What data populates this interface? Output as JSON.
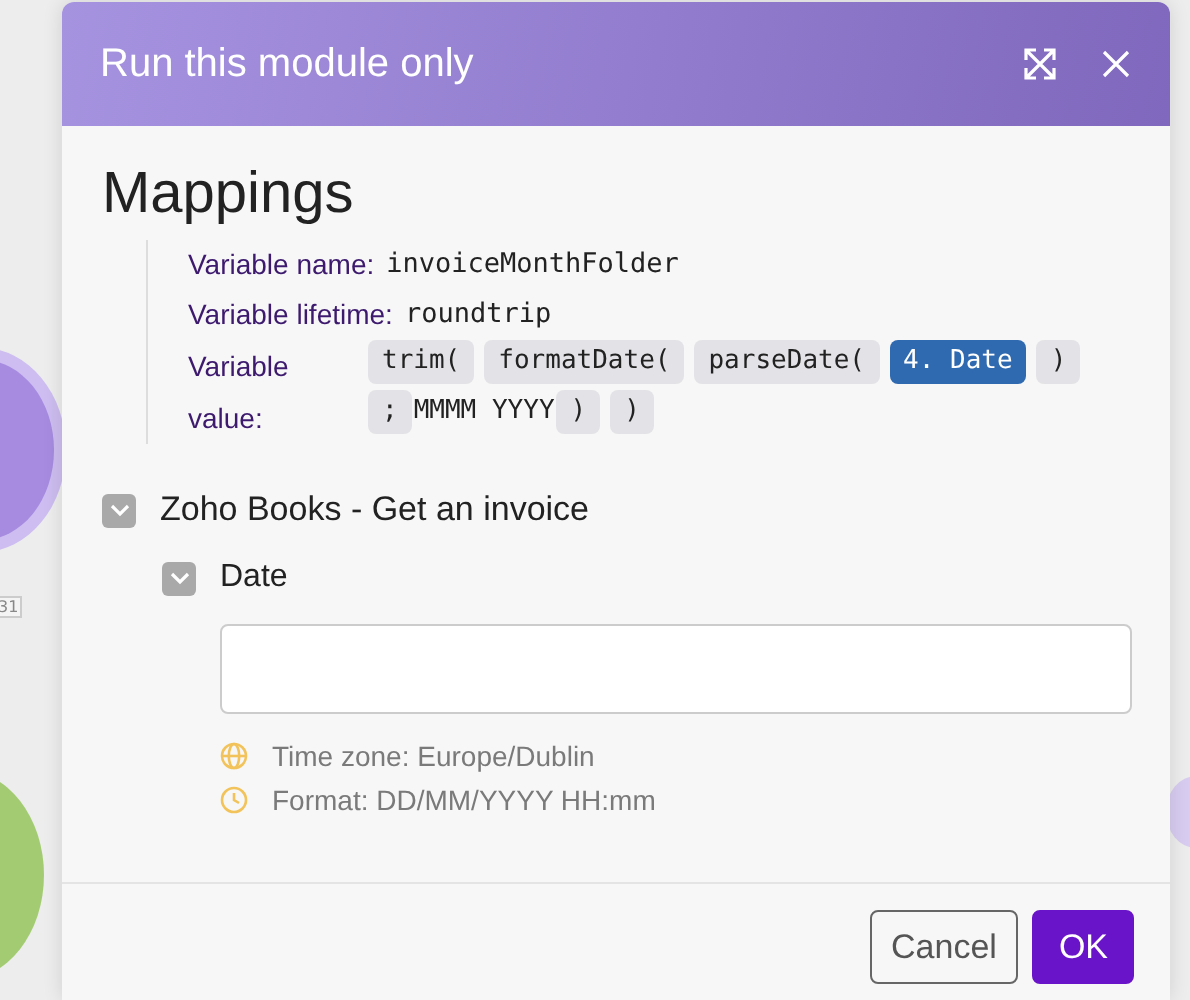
{
  "background": {
    "badge": "31"
  },
  "dialog": {
    "title": "Run this module only",
    "heading": "Mappings",
    "fields": [
      {
        "label": "Variable name:",
        "value": "invoiceMonthFolder"
      },
      {
        "label": "Variable lifetime:",
        "value": "roundtrip"
      },
      {
        "label": "Variable value:",
        "tokens": [
          {
            "kind": "function",
            "text": "trim("
          },
          {
            "kind": "function",
            "text": "formatDate("
          },
          {
            "kind": "function",
            "text": "parseDate("
          },
          {
            "kind": "item",
            "text": "4. Date"
          },
          {
            "kind": "function",
            "text": ")"
          },
          {
            "kind": "function",
            "text": ";"
          },
          {
            "kind": "text",
            "text": "MMMM YYYY"
          },
          {
            "kind": "function",
            "text": ")"
          },
          {
            "kind": "function",
            "text": ")"
          }
        ]
      }
    ],
    "section": {
      "title": "Zoho Books - Get an invoice",
      "expanded": true,
      "field": {
        "label": "Date",
        "expanded": true,
        "notes": [
          {
            "kind": "globe",
            "text": "Time zone: Europe/Dublin"
          },
          {
            "kind": "clock",
            "text": "Format: DD/MM/YYYY HH:mm"
          }
        ]
      }
    },
    "buttons": [
      {
        "kind": "secondary",
        "label": "Cancel"
      },
      {
        "kind": "primary",
        "label": "OK"
      }
    ]
  }
}
